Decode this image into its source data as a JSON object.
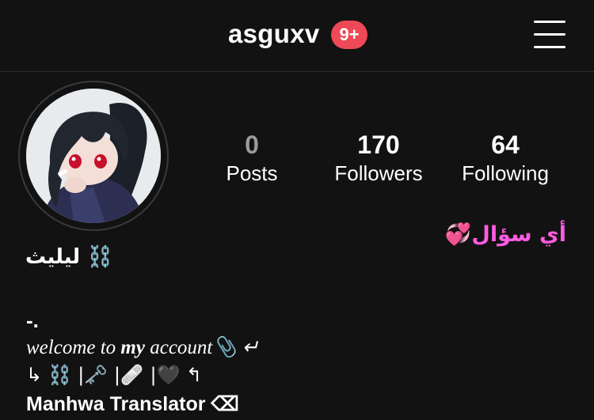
{
  "header": {
    "username": "asguxv",
    "notification_badge": "9+",
    "menu_icon": "hamburger-menu-icon"
  },
  "profile": {
    "avatar": "anime-girl-avatar",
    "display_name": "ليليث ⛓️",
    "ask_link": "أي سؤال💞"
  },
  "stats": {
    "posts": {
      "value": "0",
      "label": "Posts"
    },
    "followers": {
      "value": "170",
      "label": "Followers"
    },
    "following": {
      "value": "64",
      "label": "Following"
    }
  },
  "bio": {
    "line1": "-.",
    "welcome_prefix": "welcome to ",
    "welcome_bold": "my",
    "welcome_suffix": " account📎 ↵",
    "emoji_line": "↳ ⛓️ |🗝️ |🩹 |🖤 ↰",
    "role": "Manhwa Translator ⌫"
  },
  "colors": {
    "background": "#121212",
    "badge": "#ed4956",
    "ask_link": "#ff5ce1",
    "muted_number": "#9a9a9a"
  }
}
